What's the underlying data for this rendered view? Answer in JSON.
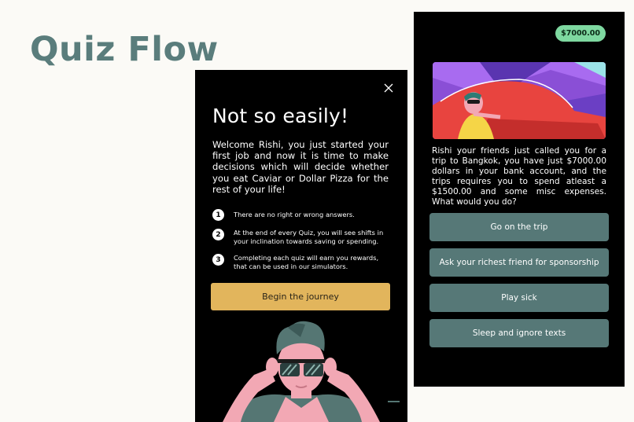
{
  "page": {
    "title": "Quiz Flow"
  },
  "intro_screen": {
    "heading": "Not so easily!",
    "description": "Welcome Rishi, you just started your first job and now it is time to make decisions which will decide whether you eat Caviar or Dollar Pizza for the rest of your life!",
    "rules": [
      {
        "number": "1",
        "text": "There are no right or wrong answers."
      },
      {
        "number": "2",
        "text": "At the end of every Quiz, you will see shifts in your inclination towards saving or spending."
      },
      {
        "number": "3",
        "text": "Completing each quiz will earn you rewards, that can be used in our simulators."
      }
    ],
    "begin_label": "Begin the journey",
    "close_icon": "close-icon"
  },
  "question_screen": {
    "balance": "$7000.00",
    "question": "Rishi your friends just called you for a trip to Bangkok, you have just $7000.00 dollars in your bank account, and the trips requires you to spend atleast a $1500.00 and some misc expenses. What would you do?",
    "options": [
      {
        "label": "Go on the trip"
      },
      {
        "label": "Ask your richest friend for sponsorship"
      },
      {
        "label": "Play sick"
      },
      {
        "label": "Sleep and ignore texts"
      }
    ]
  },
  "colors": {
    "title": "#5a7d7c",
    "begin_button": "#e2b55c",
    "option_button": "#567877",
    "balance_badge": "#7ed8a0",
    "screen_background": "#000000"
  }
}
